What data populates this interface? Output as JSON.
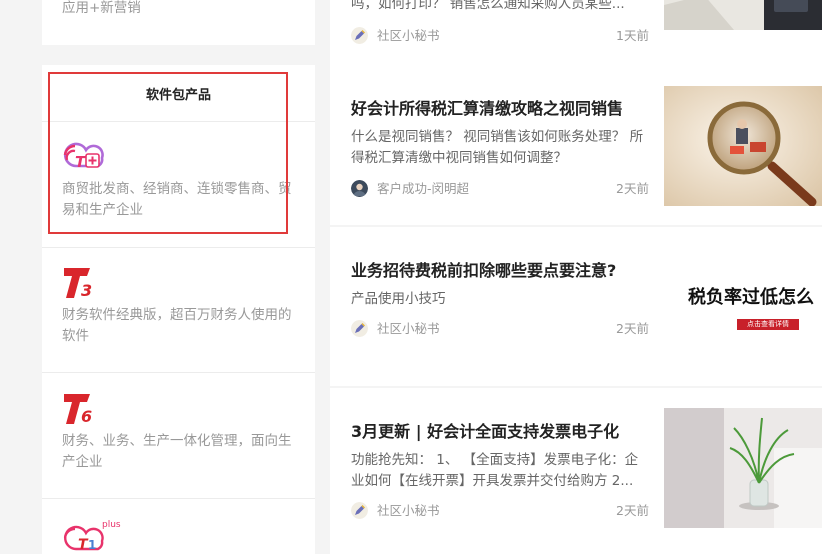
{
  "sidebar": {
    "top_desc": "应用+新营销",
    "section_title": "软件包产品",
    "products": [
      {
        "logo": "T+",
        "desc": "商贸批发商、经销商、连锁零售商、贸易和生产企业"
      },
      {
        "logo": "T3",
        "desc": "财务软件经典版，超百万财务人使用的软件"
      },
      {
        "logo": "T6",
        "desc": "财务、业务、生产一体化管理，面向生产企业"
      },
      {
        "logo": "T1",
        "logo_sup": "plus"
      }
    ]
  },
  "articles": [
    {
      "summary": "吗，如何打印？ 销售怎么通知采购人员某些...",
      "author": "社区小秘书",
      "time": "1天前",
      "avatar_icon": "pencil-avatar-icon"
    },
    {
      "title": "好会计所得税汇算清缴攻略之视同销售",
      "summary": "什么是视同销售？ 视同销售该如何账务处理？ 所得税汇算清缴中视同销售如何调整？",
      "author": "客户成功-闵明超",
      "time": "2天前",
      "avatar_icon": "person-avatar-icon"
    },
    {
      "title": "业务招待费税前扣除哪些要点要注意?",
      "summary": "产品使用小技巧",
      "author": "社区小秘书",
      "time": "2天前",
      "avatar_icon": "pencil-avatar-icon",
      "thumb_text": "税负率过低怎么",
      "thumb_button": "点击查看详情"
    },
    {
      "title": "3月更新 | 好会计全面支持发票电子化",
      "summary": "功能抢先知： 1、 【全面支持】发票电子化：企业如何【在线开票】开具发票并交付给购方 2...",
      "author": "社区小秘书",
      "time": "2天前",
      "avatar_icon": "pencil-avatar-icon"
    }
  ],
  "colors": {
    "highlight": "#e03a3a",
    "logo_red": "#d9262c",
    "logo_purple": "#9b4fd1"
  }
}
